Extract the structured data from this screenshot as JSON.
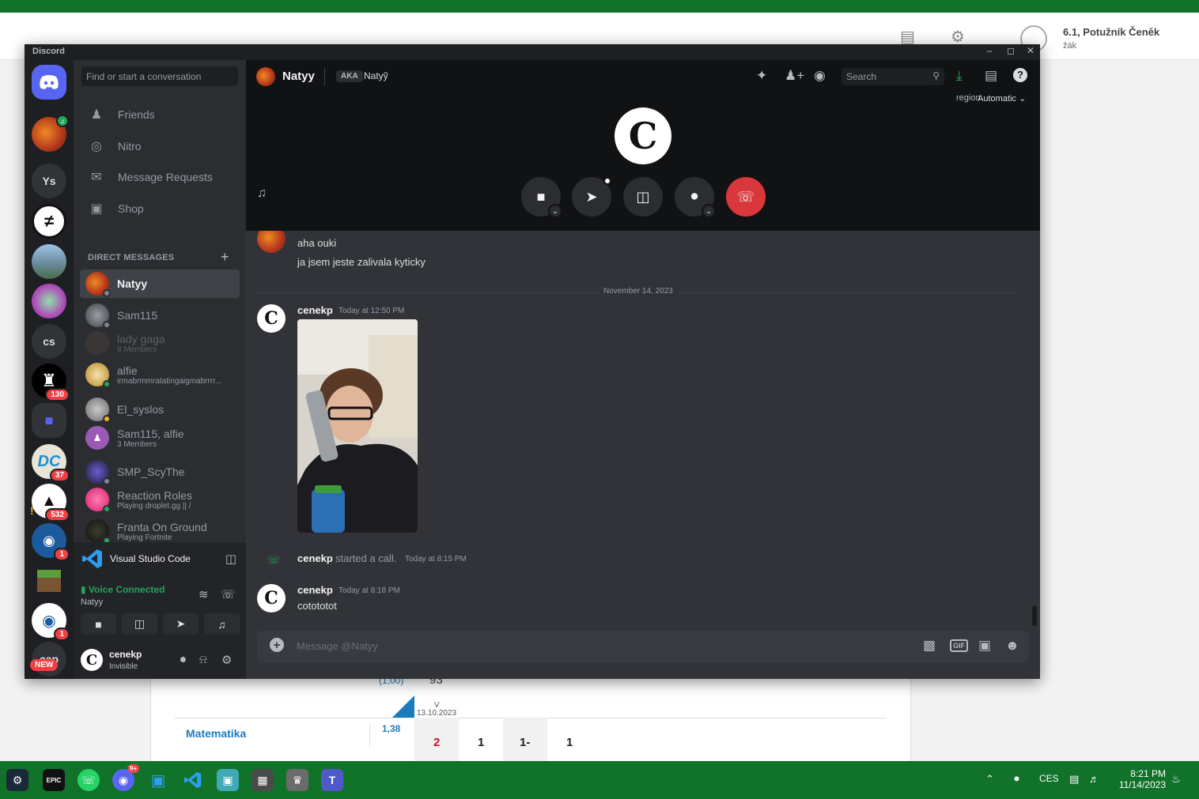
{
  "background": {
    "user_name": "6.1, Potužník Čeněk",
    "user_role": "žák",
    "grades": {
      "partial_value": "(1,00)",
      "partial_grade": "93",
      "date_letter": "V",
      "date": "13.10.2023",
      "subject": "Matematika",
      "average": "1,38",
      "marks": [
        "2",
        "1",
        "1-",
        "1"
      ]
    }
  },
  "window": {
    "title": "Discord"
  },
  "guilds": [
    {
      "id": "home",
      "icon": "discord-logo-icon"
    },
    {
      "id": "voice-server"
    },
    {
      "id": "ys",
      "label": "Ys"
    },
    {
      "id": "neq-server"
    },
    {
      "id": "landscape-server"
    },
    {
      "id": "anime-server"
    },
    {
      "id": "cs",
      "label": "cs"
    },
    {
      "id": "castle-server",
      "badge": "130"
    },
    {
      "id": "folder",
      "icon": "folder-icon"
    },
    {
      "id": "dc-server",
      "badge": "37"
    },
    {
      "id": "alert-server",
      "badge": "532"
    },
    {
      "id": "bot-server",
      "badge": "1"
    },
    {
      "id": "minecraft-server"
    },
    {
      "id": "mask-server",
      "badge": "1"
    },
    {
      "id": "cap",
      "label": "cap",
      "tag": "NEW"
    }
  ],
  "dm_panel": {
    "search_placeholder": "Find or start a conversation",
    "nav": [
      {
        "label": "Friends",
        "icon": "friends-icon"
      },
      {
        "label": "Nitro",
        "icon": "nitro-icon"
      },
      {
        "label": "Message Requests",
        "icon": "envelope-icon"
      },
      {
        "label": "Shop",
        "icon": "shop-icon"
      }
    ],
    "section_title": "DIRECT MESSAGES",
    "items": [
      {
        "name": "Natyy",
        "sub": "",
        "active": true
      },
      {
        "name": "Sam115",
        "sub": ""
      },
      {
        "name": "lady gaga",
        "sub": "8 Members",
        "dim": true
      },
      {
        "name": "alfie",
        "sub": "irmabrmmratatingaigmabrrrr..."
      },
      {
        "name": "El_syslos",
        "sub": ""
      },
      {
        "name": "Sam115, alfie",
        "sub": "3 Members"
      },
      {
        "name": "SMP_ScyThe",
        "sub": ""
      },
      {
        "name": "Reaction Roles",
        "sub": "Playing droplet.gg || /"
      },
      {
        "name": "Franta On Ground",
        "sub": "Playing Fortnite"
      }
    ]
  },
  "activity": {
    "label": "Visual Studio Code"
  },
  "voice": {
    "status": "Voice Connected",
    "channel": "Natyy"
  },
  "user": {
    "name": "cenekp",
    "status": "Invisible"
  },
  "chat_header": {
    "name": "Natyy",
    "aka_label": "AKA",
    "aka_name": "Natyỹ",
    "search_placeholder": "Search"
  },
  "call": {
    "region_label": "region",
    "region_value": "Automatic"
  },
  "messages": {
    "prev_lines": [
      "aha ouki",
      "ja jsem jeste zalivala kyticky"
    ],
    "date_divider": "November 14, 2023",
    "msg1": {
      "author": "cenekp",
      "time": "Today at 12:50 PM"
    },
    "call_event": {
      "author": "cenekp",
      "text": "started a call.",
      "time": "Today at 8:15 PM"
    },
    "msg2": {
      "author": "cenekp",
      "time": "Today at 8:18 PM",
      "text": "cotototot"
    }
  },
  "composer": {
    "placeholder": "Message @Natyy",
    "gif_label": "GIF"
  },
  "taskbar": {
    "lang": "CES",
    "time": "8:21 PM",
    "date": "11/14/2023",
    "discord_badge": "9+"
  },
  "colors": {
    "accent": "#5865f2",
    "online": "#23a55a",
    "danger": "#da373c",
    "taskbar": "#11722a"
  }
}
